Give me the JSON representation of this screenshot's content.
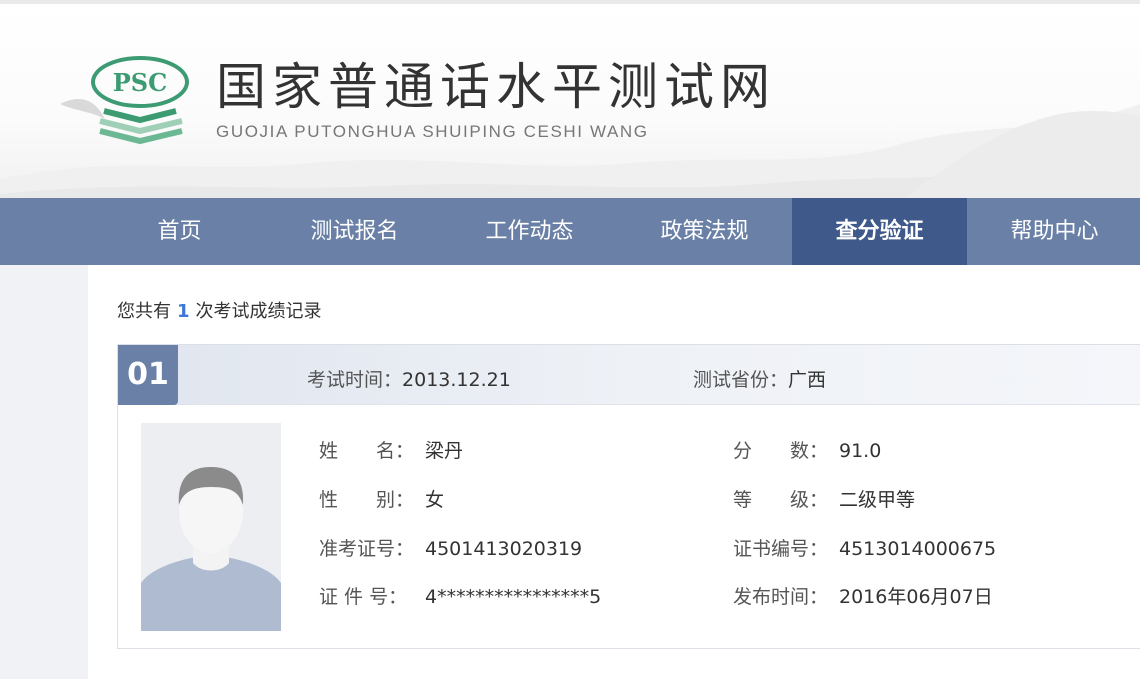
{
  "header": {
    "logo_text": "PSC",
    "title": "国家普通话水平测试网",
    "subtitle": "GUOJIA PUTONGHUA SHUIPING CESHI WANG"
  },
  "nav": {
    "items": [
      {
        "label": "首页"
      },
      {
        "label": "测试报名"
      },
      {
        "label": "工作动态"
      },
      {
        "label": "政策法规"
      },
      {
        "label": "查分验证",
        "active": true
      },
      {
        "label": "帮助中心"
      }
    ]
  },
  "summary": {
    "prefix": "您共有",
    "count": "1",
    "suffix": "次考试成绩记录"
  },
  "record": {
    "index": "01",
    "exam_time_label": "考试时间：",
    "exam_time": "2013.12.21",
    "province_label": "测试省份：",
    "province": "广西",
    "fields": {
      "name_label": "姓　　名：",
      "name": "梁丹",
      "gender_label": "性　　别：",
      "gender": "女",
      "ticket_label": "准考证号：",
      "ticket": "4501413020319",
      "id_label": "证  件  号：",
      "id": "4****************5",
      "score_label": "分　　数：",
      "score": "91.0",
      "level_label": "等　　级：",
      "level": "二级甲等",
      "cert_label": "证书编号：",
      "cert": "4513014000675",
      "issue_label": "发布时间：",
      "issue": "2016年06月07日"
    }
  },
  "colors": {
    "nav_bg": "#6a80a6",
    "nav_active": "#3f5a8a",
    "accent_number": "#3b78d8",
    "logo_green": "#3c9b72"
  }
}
